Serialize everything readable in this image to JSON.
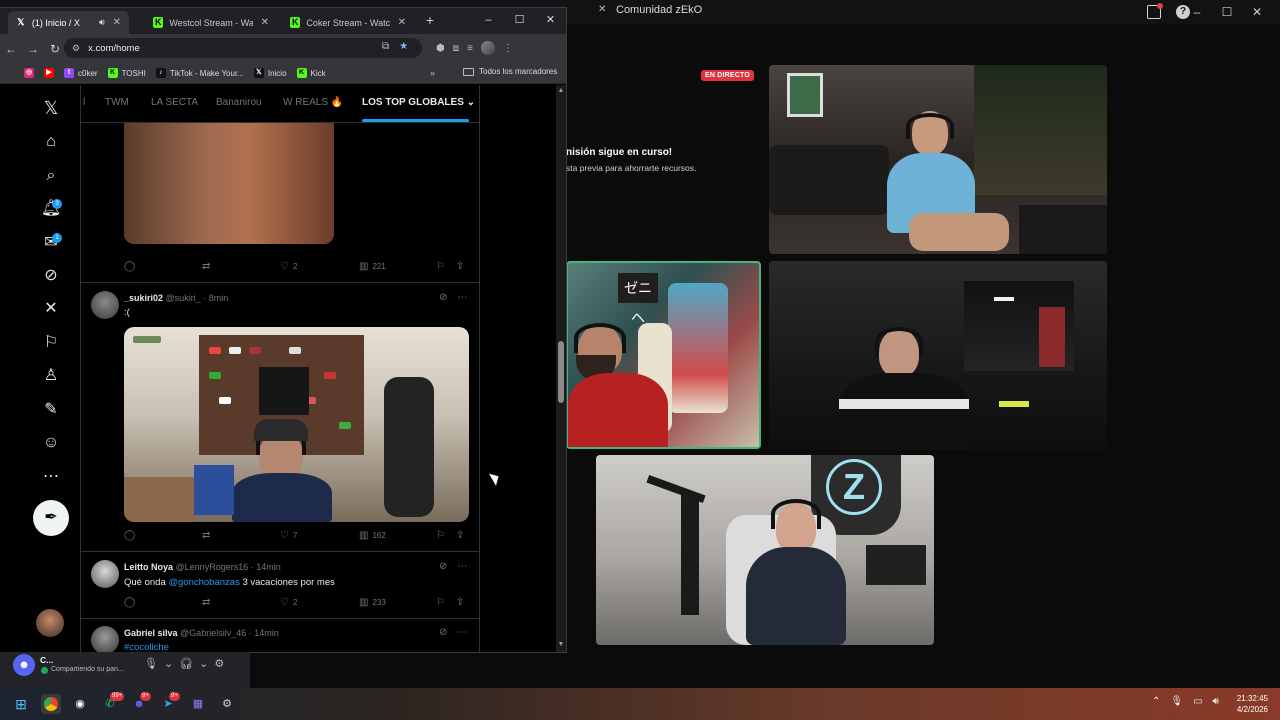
{
  "background_app": {
    "title": "Comunidad zEkO",
    "live_badge": "EN DIRECTO",
    "message_title": "nisión sigue en curso!",
    "message_sub": "sta previa para ahorrarte recursos."
  },
  "chrome": {
    "tabs": [
      {
        "title": "(1) Inicio / X",
        "favicon": "x-logo",
        "active": true
      },
      {
        "title": "Westcol Stream - Watch",
        "favicon": "kick-logo",
        "active": false
      },
      {
        "title": "Coker Stream - Watch Li",
        "favicon": "kick-logo",
        "active": false
      }
    ],
    "new_tab": "+",
    "url": "x.com/home",
    "bookmarks": [
      {
        "label": "",
        "icon": "instagram-icon",
        "color": "#d62976"
      },
      {
        "label": "",
        "icon": "youtube-icon",
        "color": "#ff0000"
      },
      {
        "label": "c0ker",
        "icon": "twitch-icon",
        "color": "#9146ff"
      },
      {
        "label": "TOSHI",
        "icon": "kick-icon",
        "color": "#53fc18"
      },
      {
        "label": "TikTok - Make Your...",
        "icon": "tiktok-icon",
        "color": "#111111"
      },
      {
        "label": "Inicio",
        "icon": "x-icon",
        "color": "#111111"
      },
      {
        "label": "Kick",
        "icon": "kick-icon",
        "color": "#53fc18"
      }
    ],
    "bookmarks_more": "»",
    "all_bookmarks": "Todos los marcadores"
  },
  "x": {
    "nav_badges": {
      "notifications": "3",
      "messages": "1"
    },
    "feed_tabs": [
      "l",
      "TWM",
      "LA SECTA",
      "Bananirou",
      "W REALS 🔥",
      "LOS TOP GLOBALES"
    ],
    "active_tab_chevron": "⌄",
    "tweets": [
      {
        "name": "",
        "handle": "",
        "text": "",
        "stats": {
          "replies": "",
          "retweets": "",
          "likes": "2",
          "views": "221"
        }
      },
      {
        "name": "_sukiri02",
        "handle": "@sukiri_ · 8min",
        "text": ":(",
        "stats": {
          "replies": "",
          "retweets": "",
          "likes": "7",
          "views": "162"
        }
      },
      {
        "name": "Leitto Noya",
        "handle": "@LennyRogers16 · 14min",
        "text_prefix": "Qué onda ",
        "mention": "@gonchobanzas",
        "text_suffix": " 3 vacaciones por mes",
        "stats": {
          "replies": "",
          "retweets": "",
          "likes": "2",
          "views": "233"
        }
      },
      {
        "name": "Gabriel silva",
        "handle": "@Gabrielsilv_46 · 14min",
        "hashtag": "#cocoliche"
      }
    ]
  },
  "discord_panel": {
    "user": "C...",
    "status": "Compartiendo su pan..."
  },
  "taskbar": {
    "badges": {
      "whatsapp": "99+",
      "discord": "9+",
      "telegram": "9+"
    },
    "time": "21:32:45",
    "date": "4/2/2026"
  }
}
